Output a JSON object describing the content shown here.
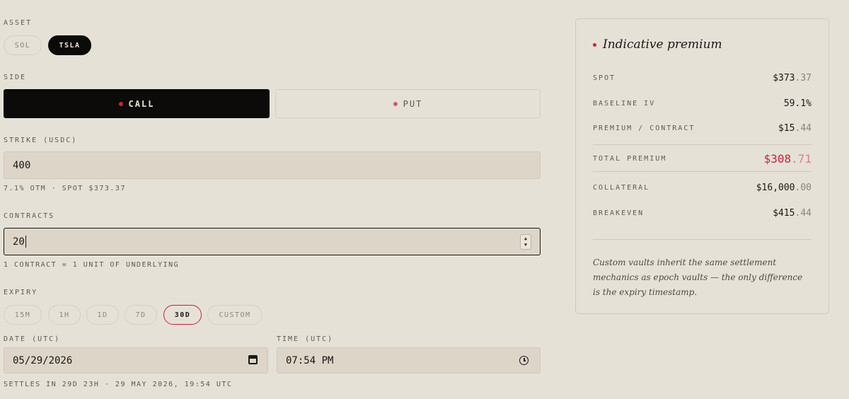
{
  "asset": {
    "label": "ASSET",
    "options": [
      "SOL",
      "TSLA"
    ],
    "selected": "TSLA"
  },
  "side": {
    "label": "SIDE",
    "call": "CALL",
    "put": "PUT",
    "selected": "CALL"
  },
  "strike": {
    "label": "STRIKE (USDC)",
    "value": "400",
    "hint": "7.1% OTM · SPOT $373.37"
  },
  "contracts": {
    "label": "CONTRACTS",
    "value": "20",
    "hint": "1 CONTRACT = 1 UNIT OF UNDERLYING"
  },
  "expiry": {
    "label": "EXPIRY",
    "options": [
      "15M",
      "1H",
      "1D",
      "7D",
      "30D",
      "CUSTOM"
    ],
    "selected": "30D"
  },
  "date": {
    "label": "DATE (UTC)",
    "value": "05/29/2026"
  },
  "time": {
    "label": "TIME (UTC)",
    "value": "07:54 PM"
  },
  "settles": "SETTLES IN 29D 23H · 29 MAY 2026, 19:54 UTC",
  "panel": {
    "title": "Indicative premium",
    "spot": {
      "label": "SPOT",
      "main": "$373",
      "dec": ".37"
    },
    "iv": {
      "label": "BASELINE IV",
      "main": "59.1%"
    },
    "premium_contract": {
      "label": "PREMIUM / CONTRACT",
      "main": "$15",
      "dec": ".44"
    },
    "total_premium": {
      "label": "TOTAL PREMIUM",
      "main": "$308",
      "dec": ".71"
    },
    "collateral": {
      "label": "COLLATERAL",
      "main": "$16,000",
      "dec": ".00"
    },
    "breakeven": {
      "label": "BREAKEVEN",
      "main": "$415",
      "dec": ".44"
    },
    "note": "Custom vaults inherit the same settlement mechanics as epoch vaults — the only difference is the expiry timestamp."
  },
  "colors": {
    "background": "#e6e1d7",
    "accent": "#c4253a",
    "active": "#0c0b09",
    "field": "#ddd5c8"
  }
}
